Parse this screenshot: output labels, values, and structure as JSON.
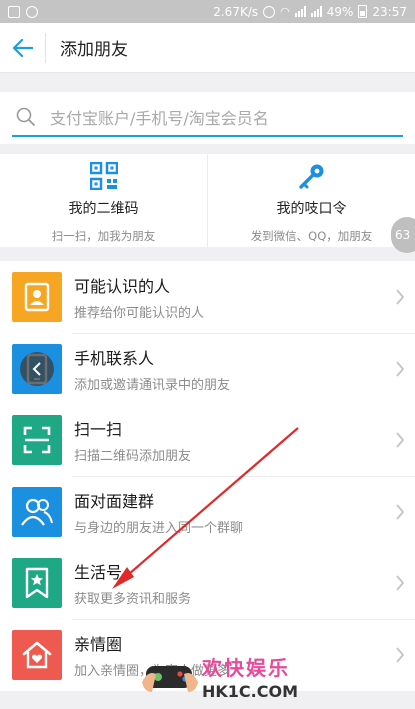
{
  "status_bar": {
    "speed": "2.67K/s",
    "battery": "49%",
    "time": "23:57"
  },
  "header": {
    "title": "添加朋友"
  },
  "search": {
    "placeholder": "支付宝账户/手机号/淘宝会员名"
  },
  "quick_cards": [
    {
      "title": "我的二维码",
      "subtitle": "扫一扫，加我为朋友",
      "icon": "qrcode-icon",
      "color": "#1a8fe3"
    },
    {
      "title": "我的吱口令",
      "subtitle": "发到微信、QQ，加朋友",
      "icon": "key-icon",
      "color": "#1a8fe3"
    }
  ],
  "section1": [
    {
      "title": "可能认识的人",
      "subtitle": "推荐给你可能认识的人",
      "icon": "contact-book-icon",
      "color": "#f6a623"
    },
    {
      "title": "手机联系人",
      "subtitle": "添加或邀请通讯录中的朋友",
      "icon": "phone-icon",
      "color": "#1b8fe0"
    }
  ],
  "section2": [
    {
      "title": "扫一扫",
      "subtitle": "扫描二维码添加朋友",
      "icon": "scan-icon",
      "color": "#1fa886"
    },
    {
      "title": "面对面建群",
      "subtitle": "与身边的朋友进入同一个群聊",
      "icon": "group-icon",
      "color": "#1b8fe0"
    }
  ],
  "section3": [
    {
      "title": "生活号",
      "subtitle": "获取更多资讯和服务",
      "icon": "life-account-icon",
      "color": "#1fa886"
    },
    {
      "title": "亲情圈",
      "subtitle": "加入亲情圈，为家人做更多",
      "icon": "family-home-icon",
      "color": "#ee5a4f"
    }
  ],
  "overlay": {
    "badge": "63"
  },
  "watermark": {
    "text": "欢快娱乐",
    "domain": "HK1C.COM"
  },
  "colors": {
    "accent": "#1a9ee6",
    "arrow": "#e02a2a"
  }
}
